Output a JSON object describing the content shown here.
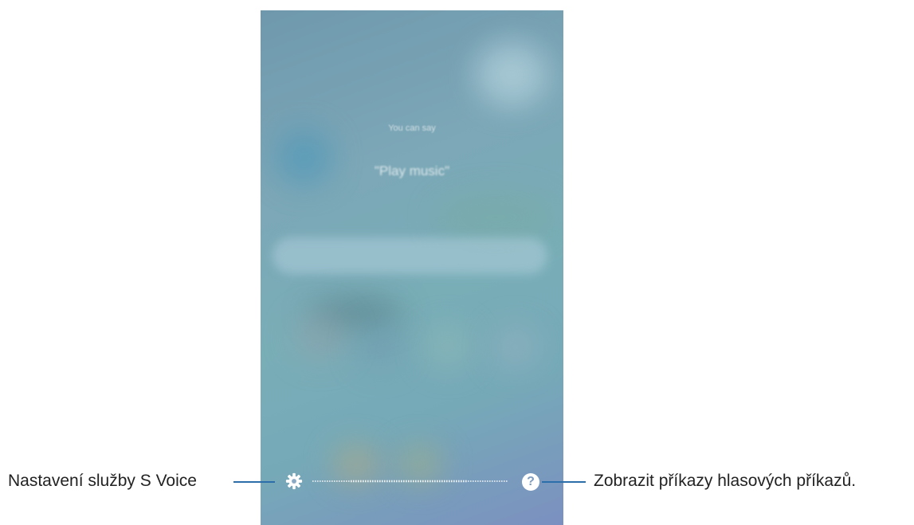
{
  "screen": {
    "hint_small": "You can say",
    "hint_example": "\"Play music\""
  },
  "toolbar": {
    "settings_icon": "gear-icon",
    "help_icon": "question-mark-icon",
    "help_glyph": "?"
  },
  "callouts": {
    "settings_label": "Nastavení služby S Voice",
    "help_label": "Zobrazit příkazy hlasových příkazů."
  },
  "colors": {
    "callout_line": "#2b6ea9",
    "screen_bg": "#79aeb7",
    "icon": "#ffffff"
  }
}
